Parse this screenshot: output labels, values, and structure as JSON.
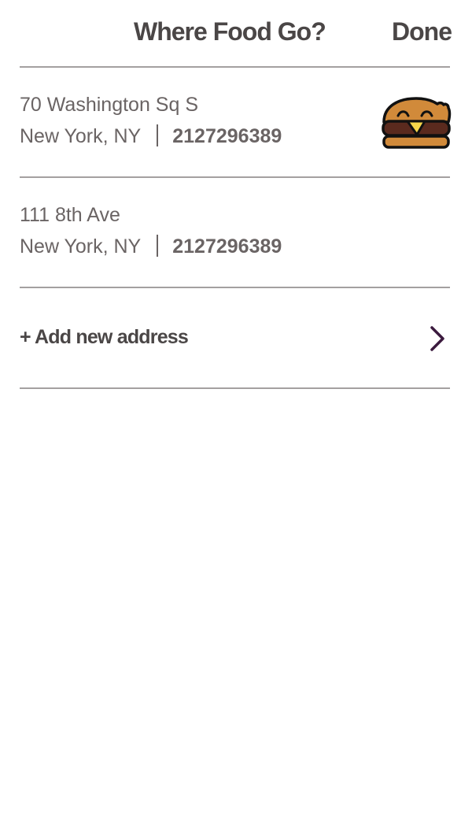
{
  "header": {
    "title": "Where Food Go?",
    "done_label": "Done"
  },
  "addresses": [
    {
      "street": "70 Washington Sq S",
      "city_state": "New York, NY",
      "phone": "2127296389",
      "selected": true,
      "selected_icon": "burger-icon"
    },
    {
      "street": "111 8th Ave",
      "city_state": "New York, NY",
      "phone": "2127296389",
      "selected": false
    }
  ],
  "add_new": {
    "label": "+ Add new address",
    "icon": "chevron-right-icon"
  },
  "colors": {
    "text": "#6a6464",
    "heading": "#4a4646",
    "divider": "#a4a0a0",
    "chevron": "#3b1a3e"
  }
}
